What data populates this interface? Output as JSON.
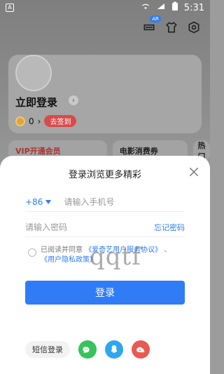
{
  "status_bar": {
    "left_icon_text": "A",
    "time": "5:31"
  },
  "top_icons": {
    "badge": "AR"
  },
  "profile": {
    "login_text": "立即登录",
    "coins": "0",
    "sign_in_pill": "去签到"
  },
  "tiles": {
    "vip": "VIP开通会员",
    "movie": "电影消费券",
    "hot": "热门"
  },
  "sheet": {
    "title": "登录浏览更多精彩",
    "phone": {
      "country_code": "+86",
      "placeholder": "请输入手机号"
    },
    "password": {
      "placeholder": "请输入密码",
      "forgot": "忘记密码"
    },
    "agreement": {
      "prefix": "已阅读并同意",
      "user_agreement": "《爱奇艺用户服务协议》",
      "sep": "、",
      "privacy": "《用户隐私政策》"
    },
    "watermark": "qqtf",
    "login_button": "登录",
    "sms_login": "短信登录"
  },
  "colors": {
    "primary": "#2f7cf6",
    "wechat": "#36c35b",
    "qq": "#2fa7f0",
    "weibo": "#e85a4f"
  }
}
